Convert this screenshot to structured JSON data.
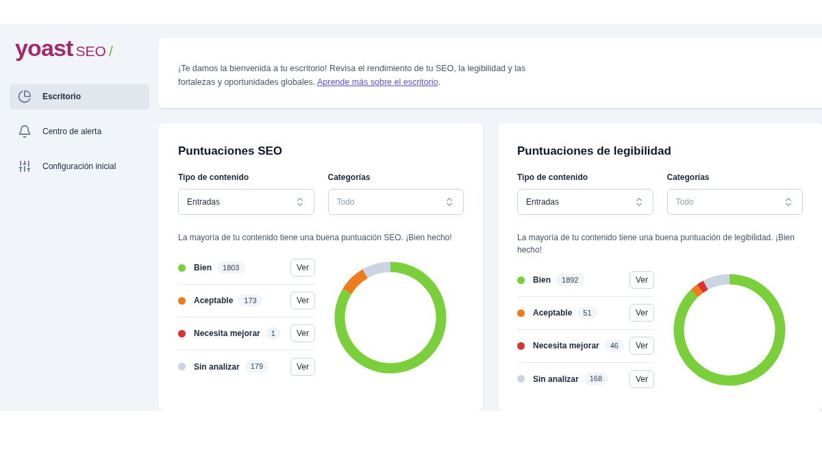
{
  "logo": {
    "wordmark": "yoast",
    "product": "SEO",
    "slash": "/"
  },
  "sidebar": {
    "items": [
      {
        "label": "Escritorio",
        "selected": true
      },
      {
        "label": "Centro de alerta",
        "selected": false
      },
      {
        "label": "Configuración inicial",
        "selected": false
      }
    ]
  },
  "welcome": {
    "text": "¡Te damos la bienvenida a tu escritorio! Revisa el rendimiento de tu SEO, la legibilidad y las fortalezas y oportunidades globales.",
    "link": "Aprende más sobre el escritorio",
    "after": "."
  },
  "cards": [
    {
      "title": "Puntuaciones SEO",
      "filters": [
        {
          "label": "Tipo de contenido",
          "value": "Entradas"
        },
        {
          "label": "Categorías",
          "placeholder": "Todo"
        }
      ],
      "message": "La mayoría de tu contenido tiene una buena puntuación SEO. ¡Bien hecho!",
      "scores": [
        {
          "label": "Bien",
          "count": "1803",
          "color": "#7ad03a",
          "button": "Ver"
        },
        {
          "label": "Aceptable",
          "count": "173",
          "color": "#ee7c1b",
          "button": "Ver"
        },
        {
          "label": "Necesita mejorar",
          "count": "1",
          "color": "#dc3232",
          "button": "Ver"
        },
        {
          "label": "Sin analizar",
          "count": "179",
          "color": "#cbd5e1",
          "button": "Ver"
        }
      ]
    },
    {
      "title": "Puntuaciones de legibilidad",
      "filters": [
        {
          "label": "Tipo de contenido",
          "value": "Entradas"
        },
        {
          "label": "Categorías",
          "placeholder": "Todo"
        }
      ],
      "message": "La mayoría de tu contenido tiene una buena puntuación de legibilidad. ¡Bien hecho!",
      "scores": [
        {
          "label": "Bien",
          "count": "1892",
          "color": "#7ad03a",
          "button": "Ver"
        },
        {
          "label": "Aceptable",
          "count": "51",
          "color": "#ee7c1b",
          "button": "Ver"
        },
        {
          "label": "Necesita mejorar",
          "count": "46",
          "color": "#dc3232",
          "button": "Ver"
        },
        {
          "label": "Sin analizar",
          "count": "168",
          "color": "#cbd5e1",
          "button": "Ver"
        }
      ]
    }
  ]
}
